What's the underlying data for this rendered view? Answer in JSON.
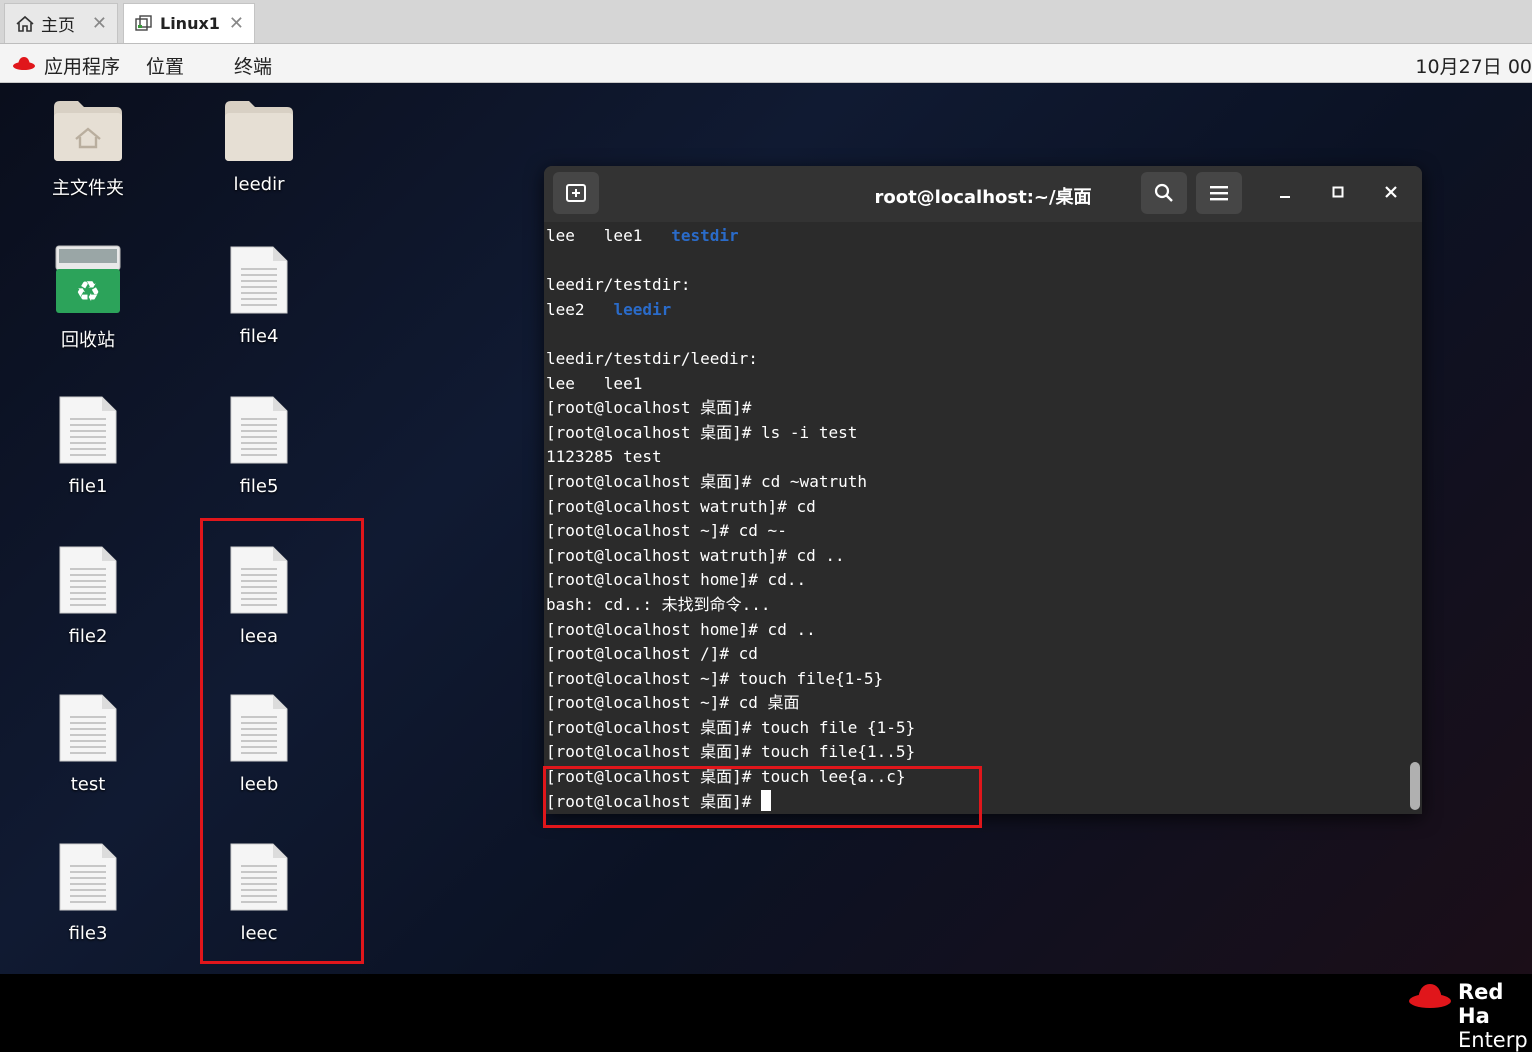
{
  "vm_tabs": {
    "home_label": "主页",
    "active_label": "Linux1",
    "close_glyph": "✕"
  },
  "gnome_bar": {
    "menu_apps": "应用程序",
    "menu_places": "位置",
    "menu_terminal": "终端",
    "clock": "10月27日 00"
  },
  "desktop": {
    "icons": {
      "home": "主文件夹",
      "leedir": "leedir",
      "trash": "回收站",
      "file4": "file4",
      "file1": "file1",
      "file5": "file5",
      "file2": "file2",
      "leea": "leea",
      "test": "test",
      "leeb": "leeb",
      "file3": "file3",
      "leec": "leec"
    },
    "brand": {
      "line1": "Red Ha",
      "line2": "Enterp"
    }
  },
  "terminal": {
    "title": "root@localhost:~/桌面",
    "lines": [
      {
        "segments": [
          {
            "t": "lee   lee1   "
          },
          {
            "t": "testdir",
            "dir": true
          }
        ]
      },
      {
        "segments": [
          {
            "t": ""
          }
        ]
      },
      {
        "segments": [
          {
            "t": "leedir/testdir:"
          }
        ]
      },
      {
        "segments": [
          {
            "t": "lee2   "
          },
          {
            "t": "leedir",
            "dir": true
          }
        ]
      },
      {
        "segments": [
          {
            "t": ""
          }
        ]
      },
      {
        "segments": [
          {
            "t": "leedir/testdir/leedir:"
          }
        ]
      },
      {
        "segments": [
          {
            "t": "lee   lee1"
          }
        ]
      },
      {
        "segments": [
          {
            "t": "[root@localhost 桌面]#"
          }
        ]
      },
      {
        "segments": [
          {
            "t": "[root@localhost 桌面]# ls -i test"
          }
        ]
      },
      {
        "segments": [
          {
            "t": "1123285 test"
          }
        ]
      },
      {
        "segments": [
          {
            "t": "[root@localhost 桌面]# cd ~watruth"
          }
        ]
      },
      {
        "segments": [
          {
            "t": "[root@localhost watruth]# cd"
          }
        ]
      },
      {
        "segments": [
          {
            "t": "[root@localhost ~]# cd ~-"
          }
        ]
      },
      {
        "segments": [
          {
            "t": "[root@localhost watruth]# cd .."
          }
        ]
      },
      {
        "segments": [
          {
            "t": "[root@localhost home]# cd.."
          }
        ]
      },
      {
        "segments": [
          {
            "t": "bash: cd..: 未找到命令..."
          }
        ]
      },
      {
        "segments": [
          {
            "t": "[root@localhost home]# cd .."
          }
        ]
      },
      {
        "segments": [
          {
            "t": "[root@localhost /]# cd"
          }
        ]
      },
      {
        "segments": [
          {
            "t": "[root@localhost ~]# touch file{1-5}"
          }
        ]
      },
      {
        "segments": [
          {
            "t": "[root@localhost ~]# cd 桌面"
          }
        ]
      },
      {
        "segments": [
          {
            "t": "[root@localhost 桌面]# touch file {1-5}"
          }
        ]
      },
      {
        "segments": [
          {
            "t": "[root@localhost 桌面]# touch file{1..5}"
          }
        ]
      },
      {
        "segments": [
          {
            "t": "[root@localhost 桌面]# touch lee{a..c}"
          }
        ]
      },
      {
        "segments": [
          {
            "t": "[root@localhost 桌面]# "
          }
        ],
        "cursor": true
      }
    ]
  }
}
